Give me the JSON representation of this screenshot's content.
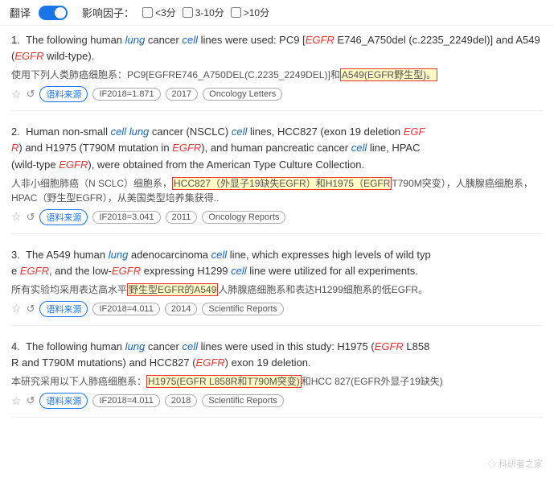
{
  "topbar": {
    "translate_label": "翻译",
    "influence_label": "影响因子：",
    "filter1": "<3分",
    "filter2": "3-10分",
    "filter3": ">10分"
  },
  "results": [
    {
      "num": "1.",
      "en_parts": [
        {
          "text": "The following human ",
          "type": "normal"
        },
        {
          "text": "lung",
          "type": "italic-blue"
        },
        {
          "text": " cancer ",
          "type": "normal"
        },
        {
          "text": "cell",
          "type": "italic-blue"
        },
        {
          "text": " lines were used: PC9 [",
          "type": "normal"
        },
        {
          "text": "EGFR",
          "type": "italic-red"
        },
        {
          "text": " E746_A750del (c.2235_2249del)] and A549 (",
          "type": "normal"
        },
        {
          "text": "EGFR",
          "type": "italic-red"
        },
        {
          "text": " wild-type).",
          "type": "normal"
        }
      ],
      "cn_parts": [
        {
          "text": "使用下列人类肺癌细胞系：PC9[EGFRE746_A750DEL(C.2235_2249DEL)]和",
          "type": "normal"
        },
        {
          "text": "A549(EGFR野生型)。",
          "type": "cn-highlight"
        }
      ],
      "if_value": "IF2018=1.871",
      "year": "2017",
      "journal": "Oncology Letters"
    },
    {
      "num": "2.",
      "en_parts": [
        {
          "text": "Human non-small ",
          "type": "normal"
        },
        {
          "text": "cell lung",
          "type": "italic-blue"
        },
        {
          "text": " cancer (NSCLC) ",
          "type": "normal"
        },
        {
          "text": "cell",
          "type": "italic-blue"
        },
        {
          "text": " lines, HCC827 (exon 19 deletion ",
          "type": "normal"
        },
        {
          "text": "EGF\nR",
          "type": "italic-red"
        },
        {
          "text": ") and H1975 (T790M mutation in ",
          "type": "normal"
        },
        {
          "text": "EGFR",
          "type": "italic-red"
        },
        {
          "text": "), and human pancreatic cancer ",
          "type": "normal"
        },
        {
          "text": "cell",
          "type": "italic-blue"
        },
        {
          "text": " line, HPAC\n(wild-type ",
          "type": "normal"
        },
        {
          "text": "EGFR",
          "type": "italic-red"
        },
        {
          "text": "), were obtained from the American Type Culture Collection.",
          "type": "normal"
        }
      ],
      "cn_parts": [
        {
          "text": "人非小细胞肺癌（N SCLC）细胞系，",
          "type": "normal"
        },
        {
          "text": "HCC827（外显子19缺失EGFR）和H1975（EGFR",
          "type": "cn-highlight"
        },
        {
          "text": "T790M突变），人胰腺癌细胞系，HPAC（野生型EGFR），从美国类型培养集获得..",
          "type": "normal"
        }
      ],
      "if_value": "IF2018=3.041",
      "year": "2011",
      "journal": "Oncology Reports"
    },
    {
      "num": "3.",
      "en_parts": [
        {
          "text": "The A549 human ",
          "type": "normal"
        },
        {
          "text": "lung",
          "type": "italic-blue"
        },
        {
          "text": " adenocarcinoma ",
          "type": "normal"
        },
        {
          "text": "cell",
          "type": "italic-blue"
        },
        {
          "text": " line, which expresses high levels of wild type\ne ",
          "type": "normal"
        },
        {
          "text": "EGFR",
          "type": "italic-red"
        },
        {
          "text": ", and the low-",
          "type": "normal"
        },
        {
          "text": "EGFR",
          "type": "italic-red"
        },
        {
          "text": " expressing H1299 ",
          "type": "normal"
        },
        {
          "text": "cell",
          "type": "italic-blue"
        },
        {
          "text": " line were utilized for all experiments.",
          "type": "normal"
        }
      ],
      "cn_parts": [
        {
          "text": "所有实验均采用表达高水平",
          "type": "normal"
        },
        {
          "text": "野生型EGFR的A549",
          "type": "cn-highlight"
        },
        {
          "text": "人肺腺癌细胞系和表达H1299细胞系的低EGFR。",
          "type": "normal"
        }
      ],
      "if_value": "IF2018=4.011",
      "year": "2014",
      "journal": "Scientific Reports"
    },
    {
      "num": "4.",
      "en_parts": [
        {
          "text": "The following human ",
          "type": "normal"
        },
        {
          "text": "lung",
          "type": "italic-blue"
        },
        {
          "text": " cancer ",
          "type": "normal"
        },
        {
          "text": "cell",
          "type": "italic-blue"
        },
        {
          "text": " lines were used in this study: H1975 (",
          "type": "normal"
        },
        {
          "text": "EGFR",
          "type": "italic-red"
        },
        {
          "text": " L858\nR and T790M mutations) and HCC827 (",
          "type": "normal"
        },
        {
          "text": "EGFR",
          "type": "italic-red"
        },
        {
          "text": ") exon 19 deletion.",
          "type": "normal"
        }
      ],
      "cn_parts": [
        {
          "text": "本研究采用以下人肺癌细胞系：",
          "type": "normal"
        },
        {
          "text": "H1975(EGFR L858R和T790M突变)",
          "type": "cn-highlight"
        },
        {
          "text": "和HCC 827(EGFR外显子19缺失)",
          "type": "normal"
        }
      ],
      "if_value": "IF2018=4.011",
      "year": "2018",
      "journal": "Scientific Reports"
    }
  ],
  "watermark": "◇ 科研者之家"
}
